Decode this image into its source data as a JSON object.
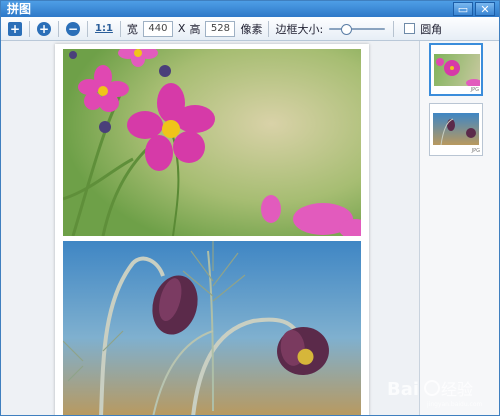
{
  "window": {
    "title": "拼图",
    "buttons": [
      "restore-icon",
      "close-icon"
    ]
  },
  "toolbar": {
    "one_to_one": "1:1",
    "width_label": "宽",
    "width_value": "440",
    "times_label": "X",
    "height_label": "高",
    "height_value": "528",
    "unit_label": "像素",
    "border_label": "边框大小:",
    "border_slider_value": 0.25,
    "rounded_label": "圆角",
    "rounded_checked": false
  },
  "thumbnails": [
    {
      "tag": "JPG"
    },
    {
      "tag": "JPG"
    }
  ],
  "colors": {
    "titlebar": "#2e79c8",
    "accent": "#3b8ddb",
    "cosmos_pink": "#d63aa8",
    "sky_blue": "#4c8ec6"
  }
}
